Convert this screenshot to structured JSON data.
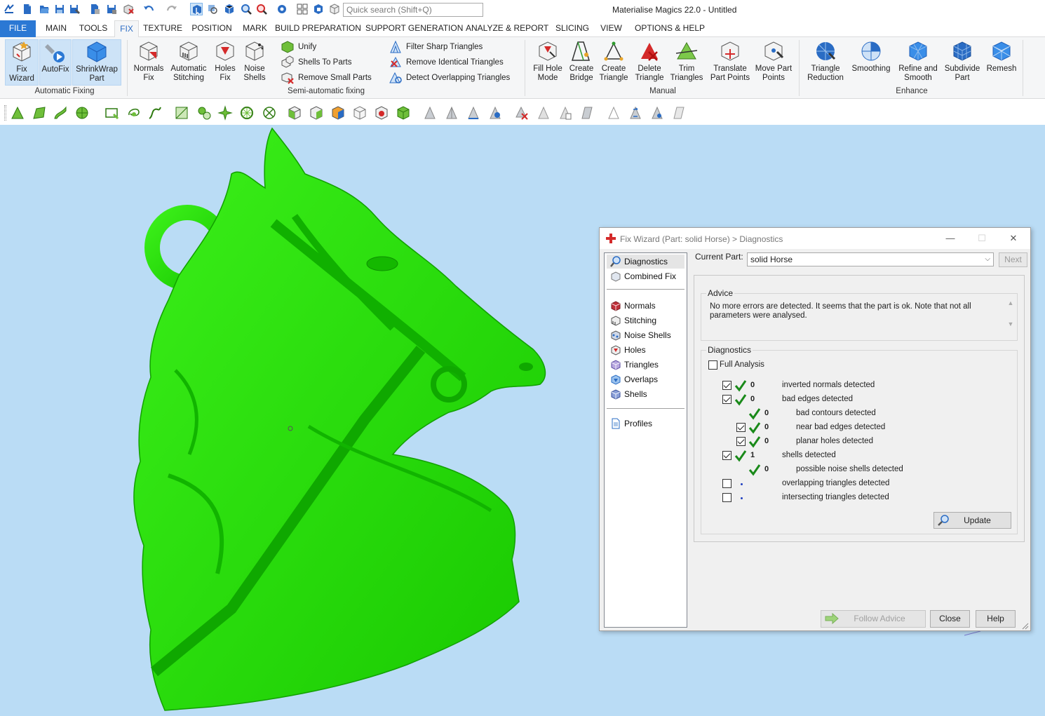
{
  "app": {
    "title": "Materialise Magics 22.0 - Untitled",
    "search_placeholder": "Quick search (Shift+Q)"
  },
  "quick_access": [
    "app-logo-icon",
    "new-file-icon",
    "open-file-icon",
    "save-icon",
    "save-as-icon",
    "import-icon",
    "export-icon",
    "close-part-icon",
    "undo-icon",
    "redo-icon",
    "select-icon",
    "view-icon",
    "box-icon",
    "zoom-icon",
    "measure-icon",
    "settings-icon",
    "parts-list-icon",
    "part-view-icon",
    "unload-icon"
  ],
  "tabs": [
    {
      "label": "FILE"
    },
    {
      "label": "MAIN"
    },
    {
      "label": "TOOLS"
    },
    {
      "label": "FIX"
    },
    {
      "label": "TEXTURE"
    },
    {
      "label": "POSITION"
    },
    {
      "label": "MARK"
    },
    {
      "label": "BUILD PREPARATION"
    },
    {
      "label": "SUPPORT GENERATION"
    },
    {
      "label": "ANALYZE & REPORT"
    },
    {
      "label": "SLICING"
    },
    {
      "label": "VIEW"
    },
    {
      "label": "OPTIONS & HELP"
    }
  ],
  "ribbon": {
    "automatic_fixing": {
      "group_label": "Automatic Fixing",
      "fix_wizard": [
        "Fix",
        "Wizard"
      ],
      "autofix": "AutoFix",
      "shrinkwrap": [
        "ShrinkWrap",
        "Part"
      ]
    },
    "semi": {
      "group_label": "Semi-automatic fixing",
      "normals_fix": [
        "Normals",
        "Fix"
      ],
      "auto_stitching": [
        "Automatic",
        "Stitching"
      ],
      "holes_fix": [
        "Holes",
        "Fix"
      ],
      "noise_shells": [
        "Noise",
        "Shells"
      ],
      "unify": "Unify",
      "shells_to_parts": "Shells To Parts",
      "remove_small_parts": "Remove Small Parts",
      "filter_sharp": "Filter Sharp Triangles",
      "remove_identical": "Remove Identical Triangles",
      "detect_overlapping": "Detect Overlapping Triangles"
    },
    "manual": {
      "group_label": "Manual",
      "fill_hole_mode": [
        "Fill Hole",
        "Mode"
      ],
      "create_bridge": [
        "Create",
        "Bridge"
      ],
      "create_triangle": [
        "Create",
        "Triangle"
      ],
      "delete_triangle": [
        "Delete",
        "Triangle"
      ],
      "trim_triangles": [
        "Trim",
        "Triangles"
      ],
      "translate_points": [
        "Translate",
        "Part Points"
      ],
      "move_points": [
        "Move Part",
        "Points"
      ]
    },
    "enhance": {
      "group_label": "Enhance",
      "triangle_reduction": [
        "Triangle",
        "Reduction"
      ],
      "smoothing": "Smoothing",
      "refine_smooth": [
        "Refine and",
        "Smooth"
      ],
      "subdivide": [
        "Subdivide",
        "Part"
      ],
      "remesh": "Remesh"
    }
  },
  "dialog": {
    "title": "Fix Wizard (Part: solid Horse) > Diagnostics",
    "nav": [
      {
        "label": "Diagnostics",
        "icon": "magnifier-icon"
      },
      {
        "label": "Combined Fix",
        "icon": "combined-fix-icon"
      },
      {
        "label": "Normals",
        "icon": "normals-icon"
      },
      {
        "label": "Stitching",
        "icon": "stitching-icon"
      },
      {
        "label": "Noise Shells",
        "icon": "noise-shells-icon"
      },
      {
        "label": "Holes",
        "icon": "holes-icon"
      },
      {
        "label": "Triangles",
        "icon": "triangles-icon"
      },
      {
        "label": "Overlaps",
        "icon": "overlaps-icon"
      },
      {
        "label": "Shells",
        "icon": "shells-icon"
      },
      {
        "label": "Profiles",
        "icon": "profiles-icon"
      }
    ],
    "current_part_label": "Current Part:",
    "current_part_value": "solid Horse",
    "next_label": "Next",
    "advice_title": "Advice",
    "advice_text": "No more errors are detected. It seems that the part is ok. Note that not all parameters were analysed.",
    "diagnostics_title": "Diagnostics",
    "full_analysis_label": "Full Analysis",
    "full_analysis_checked": false,
    "rows": [
      {
        "checked": true,
        "has_box": true,
        "status": "ok",
        "count": "0",
        "label": "inverted normals detected"
      },
      {
        "checked": true,
        "has_box": true,
        "status": "ok",
        "count": "0",
        "label": "bad edges detected"
      },
      {
        "checked": false,
        "has_box": false,
        "status": "ok",
        "count": "0",
        "label": "bad contours detected"
      },
      {
        "checked": true,
        "has_box": true,
        "status": "ok",
        "count": "0",
        "label": "near bad edges detected"
      },
      {
        "checked": true,
        "has_box": true,
        "status": "ok",
        "count": "0",
        "label": "planar holes detected"
      },
      {
        "checked": true,
        "has_box": true,
        "status": "ok",
        "count": "1",
        "label": "shells detected"
      },
      {
        "checked": false,
        "has_box": false,
        "status": "ok",
        "count": "0",
        "label": "possible noise shells detected"
      },
      {
        "checked": false,
        "has_box": true,
        "status": "none",
        "count": "",
        "label": "overlapping triangles detected"
      },
      {
        "checked": false,
        "has_box": true,
        "status": "none",
        "count": "",
        "label": "intersecting triangles detected"
      }
    ],
    "update_label": "Update",
    "follow_advice_label": "Follow Advice",
    "close_label": "Close",
    "help_label": "Help"
  },
  "colors": {
    "accent": "#2b78d4",
    "viewport_bg": "#badcf5",
    "model_green": "#22e000",
    "check_green": "#1a8a1a",
    "error_red": "#d42a2a"
  }
}
